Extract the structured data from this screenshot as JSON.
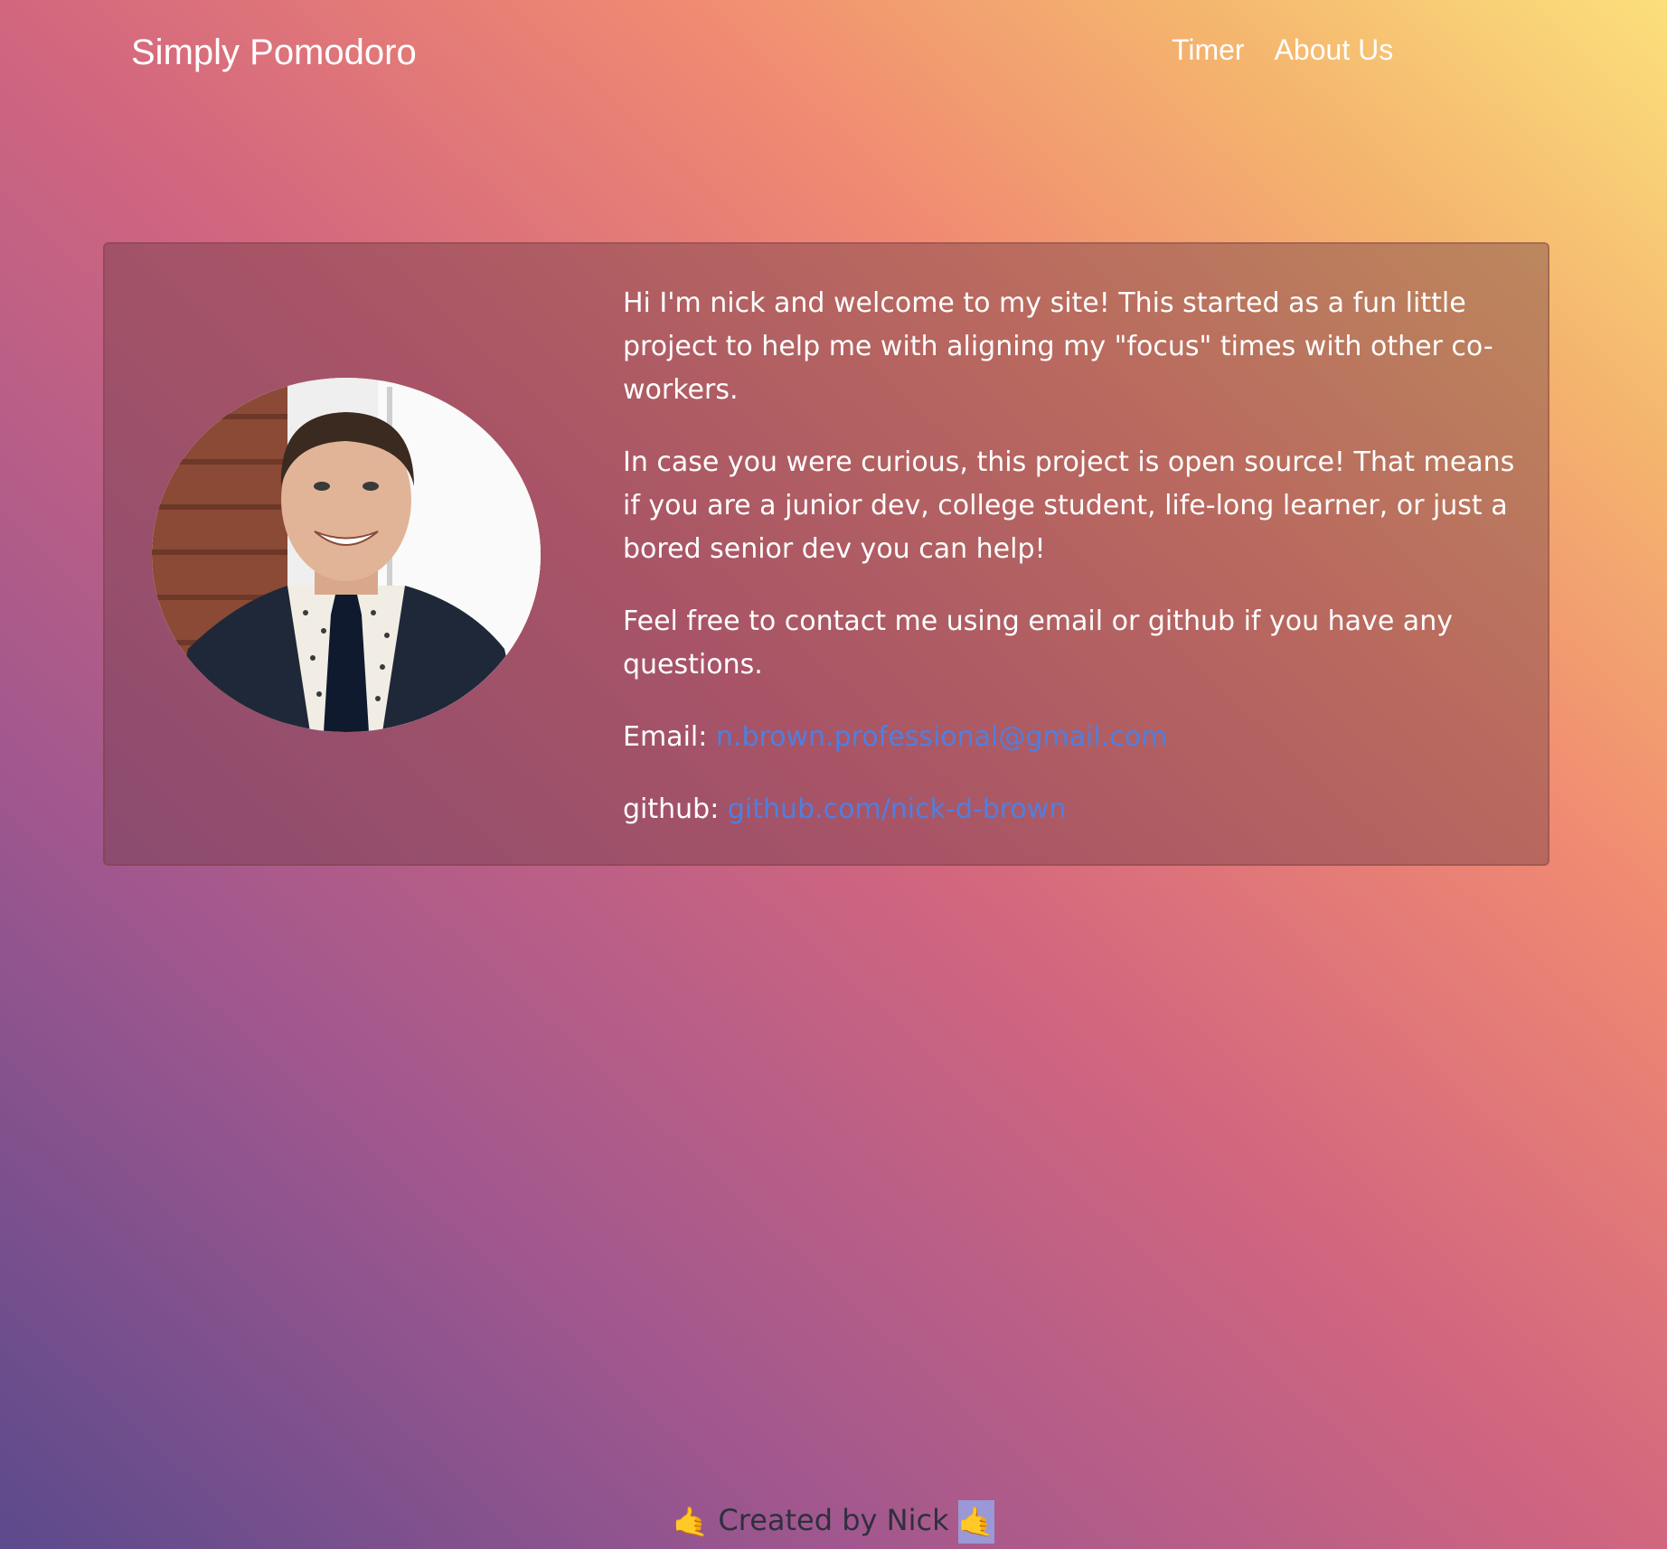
{
  "nav": {
    "brand": "Simply Pomodoro",
    "links": [
      "Timer",
      "About Us"
    ]
  },
  "about": {
    "photo_alt": "Nick portrait",
    "paragraphs": [
      "Hi I'm nick and welcome to my site! This started as a fun little project to help me with aligning my \"focus\" times with other co-workers.",
      "In case you were curious, this project is open source! That means if you are a junior dev, college student, life-long learner, or just a bored senior dev you can help!",
      "Feel free to contact me using email or github if you have any questions."
    ],
    "email_label": "Email:",
    "email": "n.brown.professional@gmail.com",
    "github_label": "github:",
    "github": "github.com/nick-d-brown"
  },
  "footer": {
    "emoji_left": "🤙",
    "text": "Created by Nick",
    "emoji_right": "🤙"
  },
  "colors": {
    "link": "#4f7fe0",
    "footer_text": "#2f2f3f",
    "gradient": [
      "#5b4a8c",
      "#d2667f",
      "#f08a72",
      "#fbe07c"
    ]
  }
}
